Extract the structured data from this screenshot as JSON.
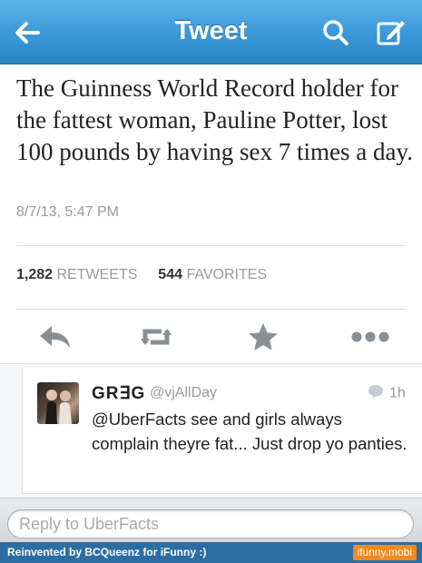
{
  "header": {
    "title": "Tweet",
    "back_icon": "arrow-left-icon",
    "search_icon": "search-icon",
    "compose_icon": "compose-icon"
  },
  "tweet": {
    "text": "The Guinness World Record holder for the fattest woman, Pauline Potter, lost 100 pounds by having sex 7 times a day.",
    "timestamp": "8/7/13, 5:47 PM",
    "retweets_count": "1,282",
    "retweets_label": "RETWEETS",
    "favorites_count": "544",
    "favorites_label": "FAVORITES"
  },
  "actions": {
    "reply_icon": "reply-icon",
    "retweet_icon": "retweet-icon",
    "favorite_icon": "star-icon",
    "more_icon": "more-icon"
  },
  "reply": {
    "name": "GR∃G",
    "handle": "@vjAllDay",
    "time": "1h",
    "text": "@UberFacts see and girls always complain theyre fat... Just drop yo panties."
  },
  "reply_box": {
    "placeholder": "Reply to UberFacts"
  },
  "watermark": {
    "left": "Reinvented by BCQueenz for iFunny :)",
    "right": "ifunny.mobi"
  },
  "colors": {
    "nav_blue": "#3b9ad9",
    "icon_gray": "#8a8f96",
    "text_dark": "#222222",
    "text_gray": "#9a9a9a"
  }
}
